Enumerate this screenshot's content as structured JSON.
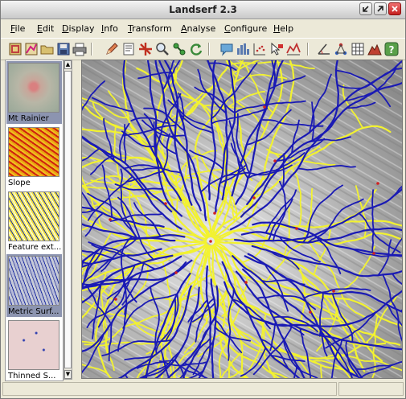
{
  "window": {
    "title": "Landserf 2.3"
  },
  "menu": [
    {
      "label": "File",
      "mnemonic": "F",
      "rest": "ile"
    },
    {
      "label": "Edit",
      "mnemonic": "E",
      "rest": "dit"
    },
    {
      "label": "Display",
      "mnemonic": "D",
      "rest": "isplay"
    },
    {
      "label": "Info",
      "mnemonic": "I",
      "rest": "nfo"
    },
    {
      "label": "Transform",
      "mnemonic": "T",
      "rest": "ransform"
    },
    {
      "label": "Analyse",
      "mnemonic": "A",
      "rest": "nalyse"
    },
    {
      "label": "Configure",
      "mnemonic": "C",
      "rest": "onfigure"
    },
    {
      "label": "Help",
      "mnemonic": "H",
      "rest": "elp"
    }
  ],
  "toolbar_icons": [
    "new-raster-icon",
    "new-vector-icon",
    "open-folder-icon",
    "save-icon",
    "print-icon",
    "pencil-icon",
    "edit-attributes-icon",
    "tool-cross-icon",
    "zoom-icon",
    "link-icon",
    "refresh-icon",
    "message-icon",
    "histogram-icon",
    "scatter-icon",
    "query-arrow-icon",
    "profile-icon",
    "angle-icon",
    "network-icon",
    "grid-icon",
    "terrain-icon",
    "help-icon"
  ],
  "layers": [
    {
      "label": "Mt Rainier",
      "selected": true,
      "kind": "dem"
    },
    {
      "label": "Slope",
      "selected": false,
      "kind": "slope"
    },
    {
      "label": "Feature ext...",
      "selected": false,
      "kind": "features"
    },
    {
      "label": "Metric Surf...",
      "selected": true,
      "kind": "metric"
    },
    {
      "label": "Thinned S...",
      "selected": false,
      "kind": "thinned"
    }
  ],
  "colors": {
    "channel": "#1a1ab4",
    "ridge": "#f2f230",
    "peak": "#d02020"
  }
}
